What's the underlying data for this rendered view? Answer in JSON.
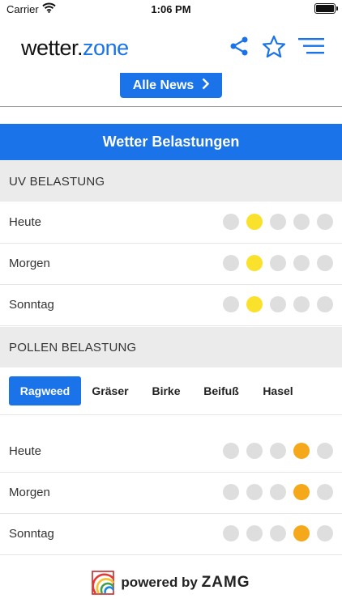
{
  "status_bar": {
    "carrier": "Carrier",
    "time": "1:06 PM"
  },
  "header": {
    "logo_part1": "wetter.",
    "logo_part2": "zone"
  },
  "news_button": {
    "label": "Alle News"
  },
  "section_title": "Wetter Belastungen",
  "uv": {
    "heading": "UV BELASTUNG",
    "rows": [
      {
        "label": "Heute",
        "level": 2
      },
      {
        "label": "Morgen",
        "level": 2
      },
      {
        "label": "Sonntag",
        "level": 2
      }
    ]
  },
  "pollen": {
    "heading": "POLLEN BELASTUNG",
    "tabs": [
      "Ragweed",
      "Gräser",
      "Birke",
      "Beifuß",
      "Hasel"
    ],
    "active_tab": "Ragweed",
    "rows": [
      {
        "label": "Heute",
        "level": 4
      },
      {
        "label": "Morgen",
        "level": 4
      },
      {
        "label": "Sonntag",
        "level": 4
      }
    ]
  },
  "footer": {
    "powered_by": "powered by",
    "brand": "ZAMG"
  },
  "colors": {
    "accent": "#1a73e8",
    "uv_active": "#f9e12c",
    "pollen_active": "#f5a81a",
    "inactive": "#dedede"
  }
}
